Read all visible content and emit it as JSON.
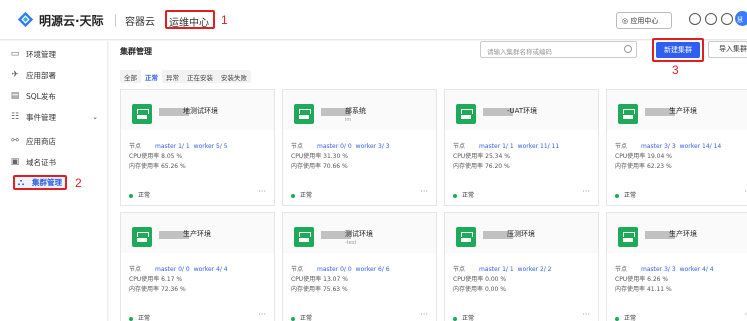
{
  "header": {
    "brand": "明源云·天际",
    "nav": [
      "容器云",
      "运维中心"
    ],
    "app_center": "应用中心",
    "avatar_text": "慧"
  },
  "annotations": [
    "1",
    "2",
    "3"
  ],
  "sidebar": {
    "items": [
      {
        "label": "环境管理",
        "icon": "folder-icon"
      },
      {
        "label": "应用部署",
        "icon": "rocket-icon"
      },
      {
        "label": "SQL发布",
        "icon": "database-icon"
      },
      {
        "label": "事件管理",
        "icon": "event-icon"
      },
      {
        "label": "应用商店",
        "icon": "store-icon"
      },
      {
        "label": "域名证书",
        "icon": "certificate-icon"
      },
      {
        "label": "集群管理",
        "icon": "cluster-icon"
      }
    ]
  },
  "main": {
    "title": "集群管理",
    "search_placeholder": "请输入集群名称或编码",
    "new_button": "新建集群",
    "import_button": "导入集群",
    "filters": [
      "全部",
      "正常",
      "异常",
      "正在安装",
      "安装失败"
    ]
  },
  "cards": [
    {
      "name": "地测试环境",
      "sub": "",
      "master": "master 1/ 1",
      "worker": "worker 5/ 5",
      "cpu": "8.05 %",
      "mem": "65.26 %",
      "status": "正常"
    },
    {
      "name": "部系统",
      "sub": "im",
      "master": "master 0/ 0",
      "worker": "worker 3/ 3",
      "cpu": "31.30 %",
      "mem": "70.66 %",
      "status": "正常"
    },
    {
      "name": "-UAT环境",
      "sub": "",
      "master": "master 1/ 1",
      "worker": "worker 11/ 11",
      "cpu": "25.34 %",
      "mem": "76.20 %",
      "status": "正常"
    },
    {
      "name": "生产环境",
      "sub": "",
      "master": "master 3/ 3",
      "worker": "worker 14/ 14",
      "cpu": "19.04 %",
      "mem": "62.23 %",
      "status": "正常"
    },
    {
      "name": "生产环境",
      "sub": "",
      "master": "master 0/ 0",
      "worker": "worker 4/ 4",
      "cpu": "6.17 %",
      "mem": "72.36 %",
      "status": "正常"
    },
    {
      "name": "测试环境",
      "sub": "-test",
      "master": "master 0/ 0",
      "worker": "worker 6/ 6",
      "cpu": "13.07 %",
      "mem": "75.63 %",
      "status": "正常"
    },
    {
      "name": "压测环境",
      "sub": "",
      "master": "master 1/ 1",
      "worker": "worker 2/ 2",
      "cpu": "0.00 %",
      "mem": "0.00 %",
      "status": "正常"
    },
    {
      "name": "生产环境",
      "sub": "",
      "master": "master 3/ 3",
      "worker": "worker 4/ 4",
      "cpu": "6.26 %",
      "mem": "41.11 %",
      "status": "正常"
    }
  ],
  "labels": {
    "node": "节点",
    "cpu": "CPU使用率",
    "mem": "内存使用率"
  },
  "colors": {
    "primary": "#2f5ff0",
    "success": "#1faa5a",
    "annotation": "#e02020"
  }
}
